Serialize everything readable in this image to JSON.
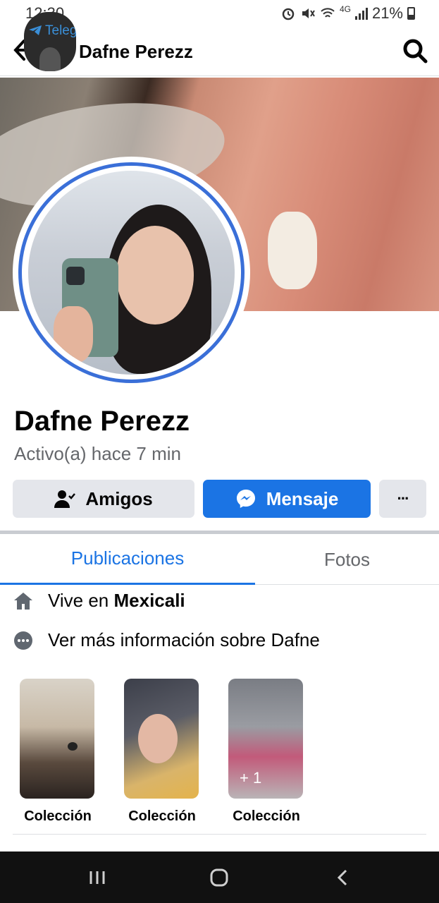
{
  "status_bar": {
    "time": "12:30",
    "network": "4G",
    "battery": "21%"
  },
  "telegram_bubble": {
    "label": "Teleg"
  },
  "header": {
    "title": "Dafne Perezz"
  },
  "profile": {
    "name": "Dafne Perezz",
    "activity": "Activo(a) hace 7 min"
  },
  "actions": {
    "friends_label": "Amigos",
    "message_label": "Mensaje",
    "more_label": "···"
  },
  "tabs": [
    {
      "label": "Publicaciones",
      "active": true
    },
    {
      "label": "Fotos",
      "active": false
    }
  ],
  "intro": {
    "lives_prefix": "Vive en ",
    "lives_city": "Mexicali",
    "more_info": "Ver más información sobre Dafne"
  },
  "collections": [
    {
      "caption": "Colección"
    },
    {
      "caption": "Colección"
    },
    {
      "caption": "Colección",
      "extra_count": "+ 1"
    }
  ],
  "colors": {
    "accent": "#1b74e4",
    "ring": "#3a6fd8",
    "muted_text": "#65676b",
    "button_gray": "#e4e6eb"
  }
}
